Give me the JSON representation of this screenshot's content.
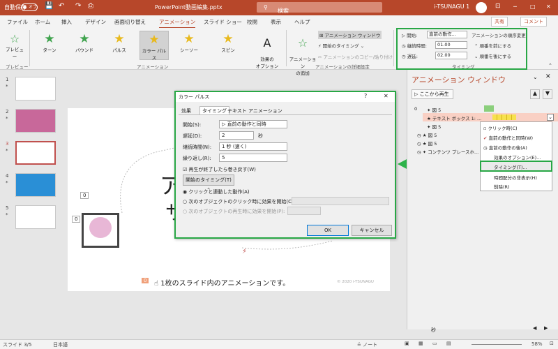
{
  "titlebar": {
    "autosave": "自動保存",
    "autosave_state": "オフ",
    "filename": "PowerPoint動画編集.pptx",
    "search_placeholder": "検索",
    "user": "i-TSUNAGU 1",
    "minimize": "─",
    "maximize": "□",
    "close": "✕"
  },
  "tabs": [
    "ファイル",
    "ホーム",
    "挿入",
    "デザイン",
    "画面切り替え",
    "アニメーション",
    "スライド ショー",
    "校閲",
    "表示",
    "ヘルプ"
  ],
  "share": "共有",
  "comment": "コメント",
  "ribbon": {
    "preview": "プレビュー",
    "preview_group": "プレビュー",
    "animations": [
      "ターン",
      "バウンド",
      "パルス",
      "カラー パルス",
      "シーソー",
      "スピン"
    ],
    "effect_options": "効果の\nオプション",
    "animation_group": "アニメーション",
    "add_animation": "アニメーション\nの追加",
    "anim_pane": "アニメーション ウィンドウ",
    "start_timing": "開始のタイミング",
    "anim_painter": "アニメーションのコピー/貼り付け",
    "advanced_group": "アニメーションの詳細設定",
    "start_label": "開始:",
    "start_value": "直前の動作...",
    "duration_label": "継続時間:",
    "duration_value": "01.00",
    "delay_label": "遅延:",
    "delay_value": "02.00",
    "reorder": "アニメーションの順序変更",
    "move_earlier": "順番を前にする",
    "move_later": "順番を後にする",
    "timing_group": "タイミング"
  },
  "thumbs": [
    {
      "num": "1",
      "star": "*"
    },
    {
      "num": "2",
      "star": "*"
    },
    {
      "num": "3",
      "star": "*"
    },
    {
      "num": "4",
      "star": "*"
    },
    {
      "num": "5",
      "star": "*"
    }
  ],
  "slide": {
    "caption": "1枚のスライド内のアニメーションです。",
    "caption_tag": "0",
    "copyright": "© 2020 i-TSUNAGU",
    "tag0": "0",
    "tag1": "1",
    "tag2": "0",
    "big_text1": "ア",
    "big_text2": "サ"
  },
  "pane": {
    "title": "アニメーション ウィンドウ",
    "play_from": "ここから再生",
    "rows": [
      {
        "num": "0",
        "label": "図 5"
      },
      {
        "num": "",
        "label": "テキスト ボックス 1: ..."
      },
      {
        "num": "",
        "label": "図 5"
      },
      {
        "num": "",
        "label": "図 5"
      },
      {
        "num": "",
        "label": "図 5"
      },
      {
        "num": "",
        "label": "コンテンツ プレースホ..."
      }
    ],
    "seconds": "秒",
    "menu": [
      "クリック時(C)",
      "直前の動作と同時(W)",
      "直前の動作の後(A)",
      "効果のオプション(E)...",
      "タイミング(T)...",
      "時間配分の非表示(H)",
      "削除(R)"
    ]
  },
  "dialog": {
    "title": "カラー パルス",
    "help": "?",
    "close": "✕",
    "tabs": [
      "効果",
      "タイミング",
      "テキスト アニメーション"
    ],
    "start_label": "開始(S):",
    "start_value": "直前の動作と同時",
    "delay_label": "遅延(D):",
    "delay_value": "2",
    "delay_unit": "秒",
    "duration_label": "継続時間(N):",
    "duration_value": "1 秒 (速く)",
    "repeat_label": "繰り返し(R):",
    "repeat_value": "5",
    "rewind_label": "再生が終了したら巻き戻す(W)",
    "triggers_btn": "開始のタイミング(T)",
    "opt1": "クリックと連動した動作(A)",
    "opt2": "次のオブジェクトのクリック時に効果を開始(C):",
    "opt3": "次のオブジェクトの再生時に効果を開始(P):",
    "ok": "OK",
    "cancel": "キャンセル"
  },
  "status": {
    "slide": "スライド 3/5",
    "language": "日本語",
    "notes": "ノート",
    "zoom": "58%"
  },
  "colors": {
    "accent": "#b7472a",
    "highlight": "#28a745",
    "star_green": "#3fa34d",
    "star_yellow": "#e8b91c"
  }
}
